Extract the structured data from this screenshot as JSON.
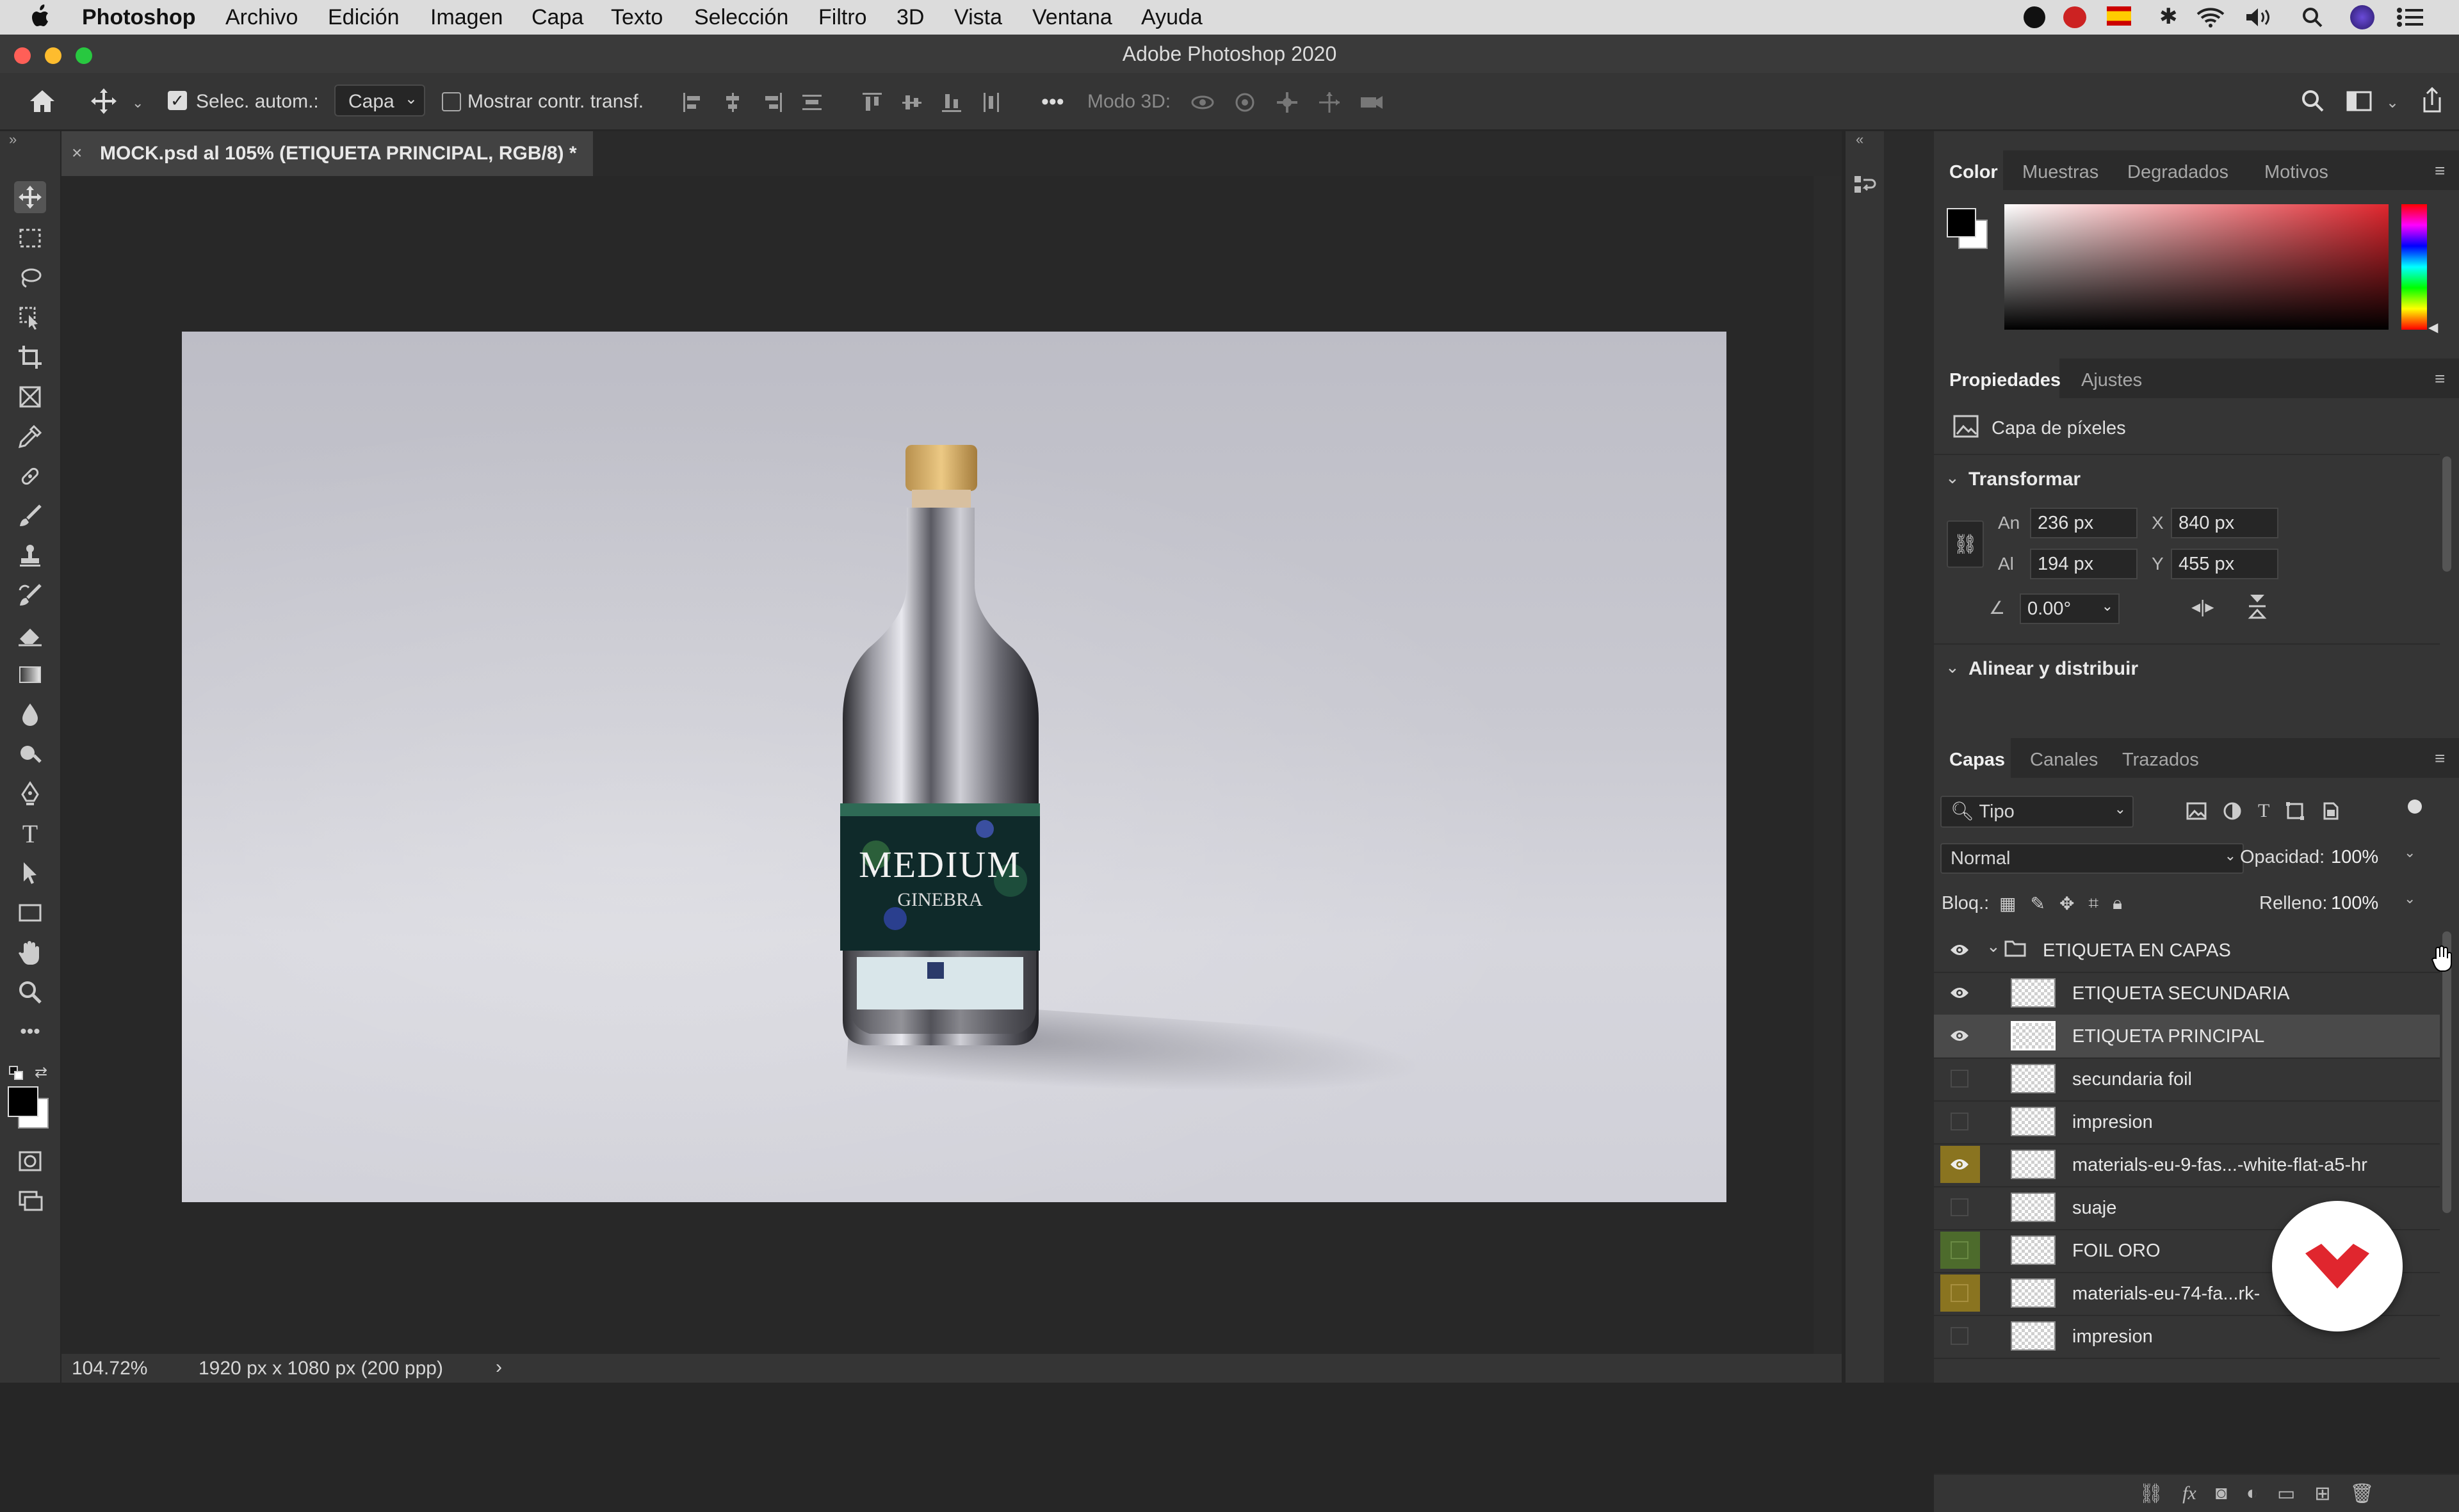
{
  "menubar": {
    "app": "Photoshop",
    "items": [
      "Archivo",
      "Edición",
      "Imagen",
      "Capa",
      "Texto",
      "Selección",
      "Filtro",
      "3D",
      "Vista",
      "Ventana",
      "Ayuda"
    ]
  },
  "window": {
    "title": "Adobe Photoshop 2020"
  },
  "options_bar": {
    "auto_select_label": "Selec. autom.:",
    "auto_select_value": "Capa",
    "show_transform_label": "Mostrar contr. transf.",
    "mode_3d_label": "Modo 3D:"
  },
  "document_tab": {
    "title": "MOCK.psd al 105% (ETIQUETA PRINCIPAL, RGB/8) *"
  },
  "canvas": {
    "label_main": "MEDIUM",
    "label_sub": "GINEBRA"
  },
  "status_bar": {
    "zoom": "104.72%",
    "doc_info": "1920 px x 1080 px (200 ppp)",
    "arrow": "›"
  },
  "color_panel": {
    "tabs": [
      "Color",
      "Muestras",
      "Degradados",
      "Motivos"
    ],
    "active": "Color"
  },
  "properties_panel": {
    "tabs": [
      "Propiedades",
      "Ajustes"
    ],
    "layer_type": "Capa de píxeles",
    "transform_title": "Transformar",
    "width_label": "An",
    "width_value": "236 px",
    "height_label": "Al",
    "height_value": "194 px",
    "x_label": "X",
    "x_value": "840 px",
    "y_label": "Y",
    "y_value": "455 px",
    "angle_value": "0.00°",
    "align_title": "Alinear y distribuir"
  },
  "layers_panel": {
    "tabs": [
      "Capas",
      "Canales",
      "Trazados"
    ],
    "filter_value": "Tipo",
    "blend_mode": "Normal",
    "opacity_label": "Opacidad:",
    "opacity_value": "100%",
    "lock_label": "Bloq.:",
    "fill_label": "Relleno:",
    "fill_value": "100%",
    "group_name": "ETIQUETA EN CAPAS",
    "layers": [
      {
        "name": "ETIQUETA SECUNDARIA",
        "visible": true,
        "tag": ""
      },
      {
        "name": "ETIQUETA PRINCIPAL",
        "visible": true,
        "tag": "",
        "selected": true
      },
      {
        "name": "secundaria foil",
        "visible": false,
        "tag": ""
      },
      {
        "name": "impresion",
        "visible": false,
        "tag": ""
      },
      {
        "name": "materials-eu-9-fas...-white-flat-a5-hr",
        "visible": true,
        "tag": "#8a7420"
      },
      {
        "name": "suaje",
        "visible": false,
        "tag": ""
      },
      {
        "name": "FOIL ORO",
        "visible": false,
        "tag": "#4d6b2c"
      },
      {
        "name": "materials-eu-74-fa...rk-",
        "visible": false,
        "tag": "#8a7420"
      },
      {
        "name": "impresion",
        "visible": false,
        "tag": ""
      }
    ]
  },
  "colors": {
    "accent": "#e0262e",
    "panel_bg": "#353535"
  }
}
